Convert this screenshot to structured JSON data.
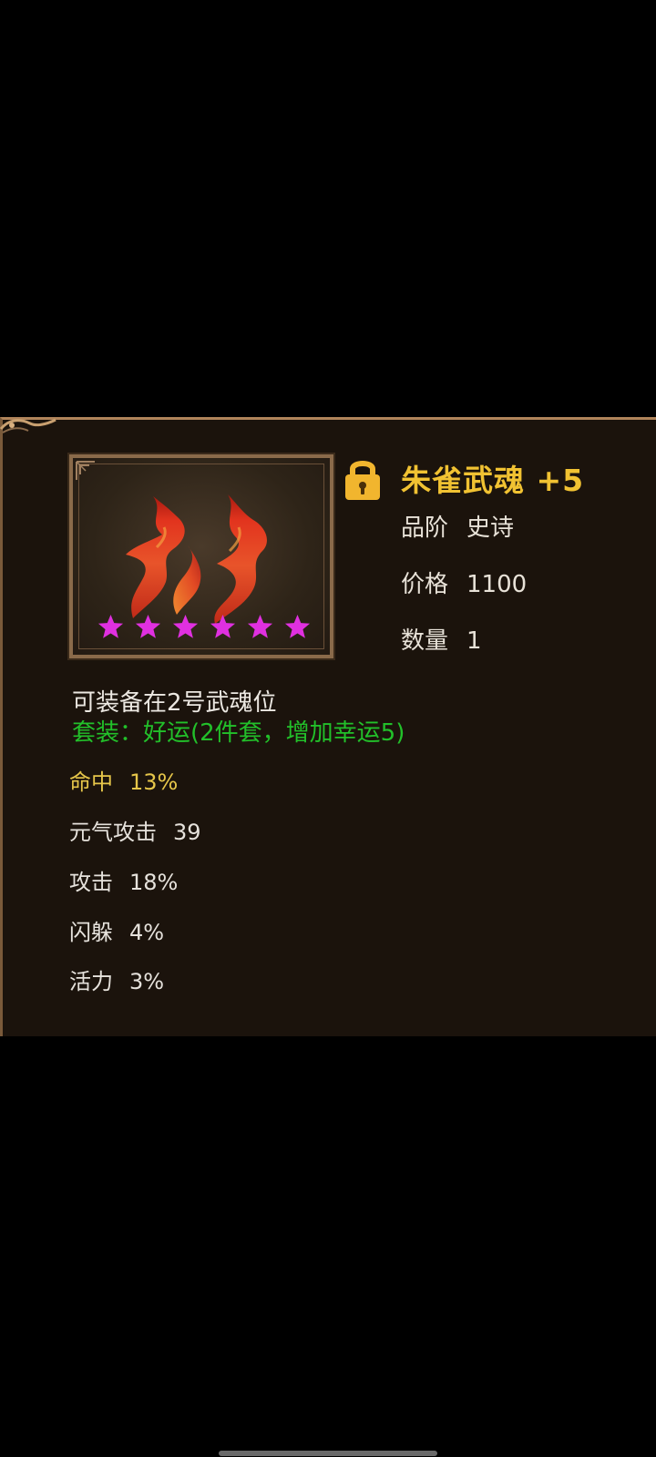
{
  "item": {
    "name": "朱雀武魂 +5",
    "locked": true,
    "star_count": 6,
    "meta": [
      {
        "label": "品阶",
        "value": "史诗"
      },
      {
        "label": "价格",
        "value": "1100"
      },
      {
        "label": "数量",
        "value": "1"
      }
    ],
    "equip_slot_text": "可装备在2号武魂位",
    "set_bonus_text": "套装：好运(2件套，增加幸运5)",
    "stats": [
      {
        "label": "命中",
        "value": "13%",
        "highlight": true
      },
      {
        "label": "元气攻击",
        "value": "39",
        "highlight": false
      },
      {
        "label": "攻击",
        "value": "18%",
        "highlight": false
      },
      {
        "label": "闪躲",
        "value": "4%",
        "highlight": false
      },
      {
        "label": "活力",
        "value": "3%",
        "highlight": false
      }
    ]
  },
  "icons": {
    "lock": "padlock-icon",
    "item": "flame-soul-icon",
    "star": "star-icon"
  },
  "colors": {
    "item_name": "#f1c232",
    "set_bonus": "#22c02a",
    "stat_highlight": "#e6c64a",
    "star": "#e030e0",
    "panel_bg": "#1b130c"
  }
}
